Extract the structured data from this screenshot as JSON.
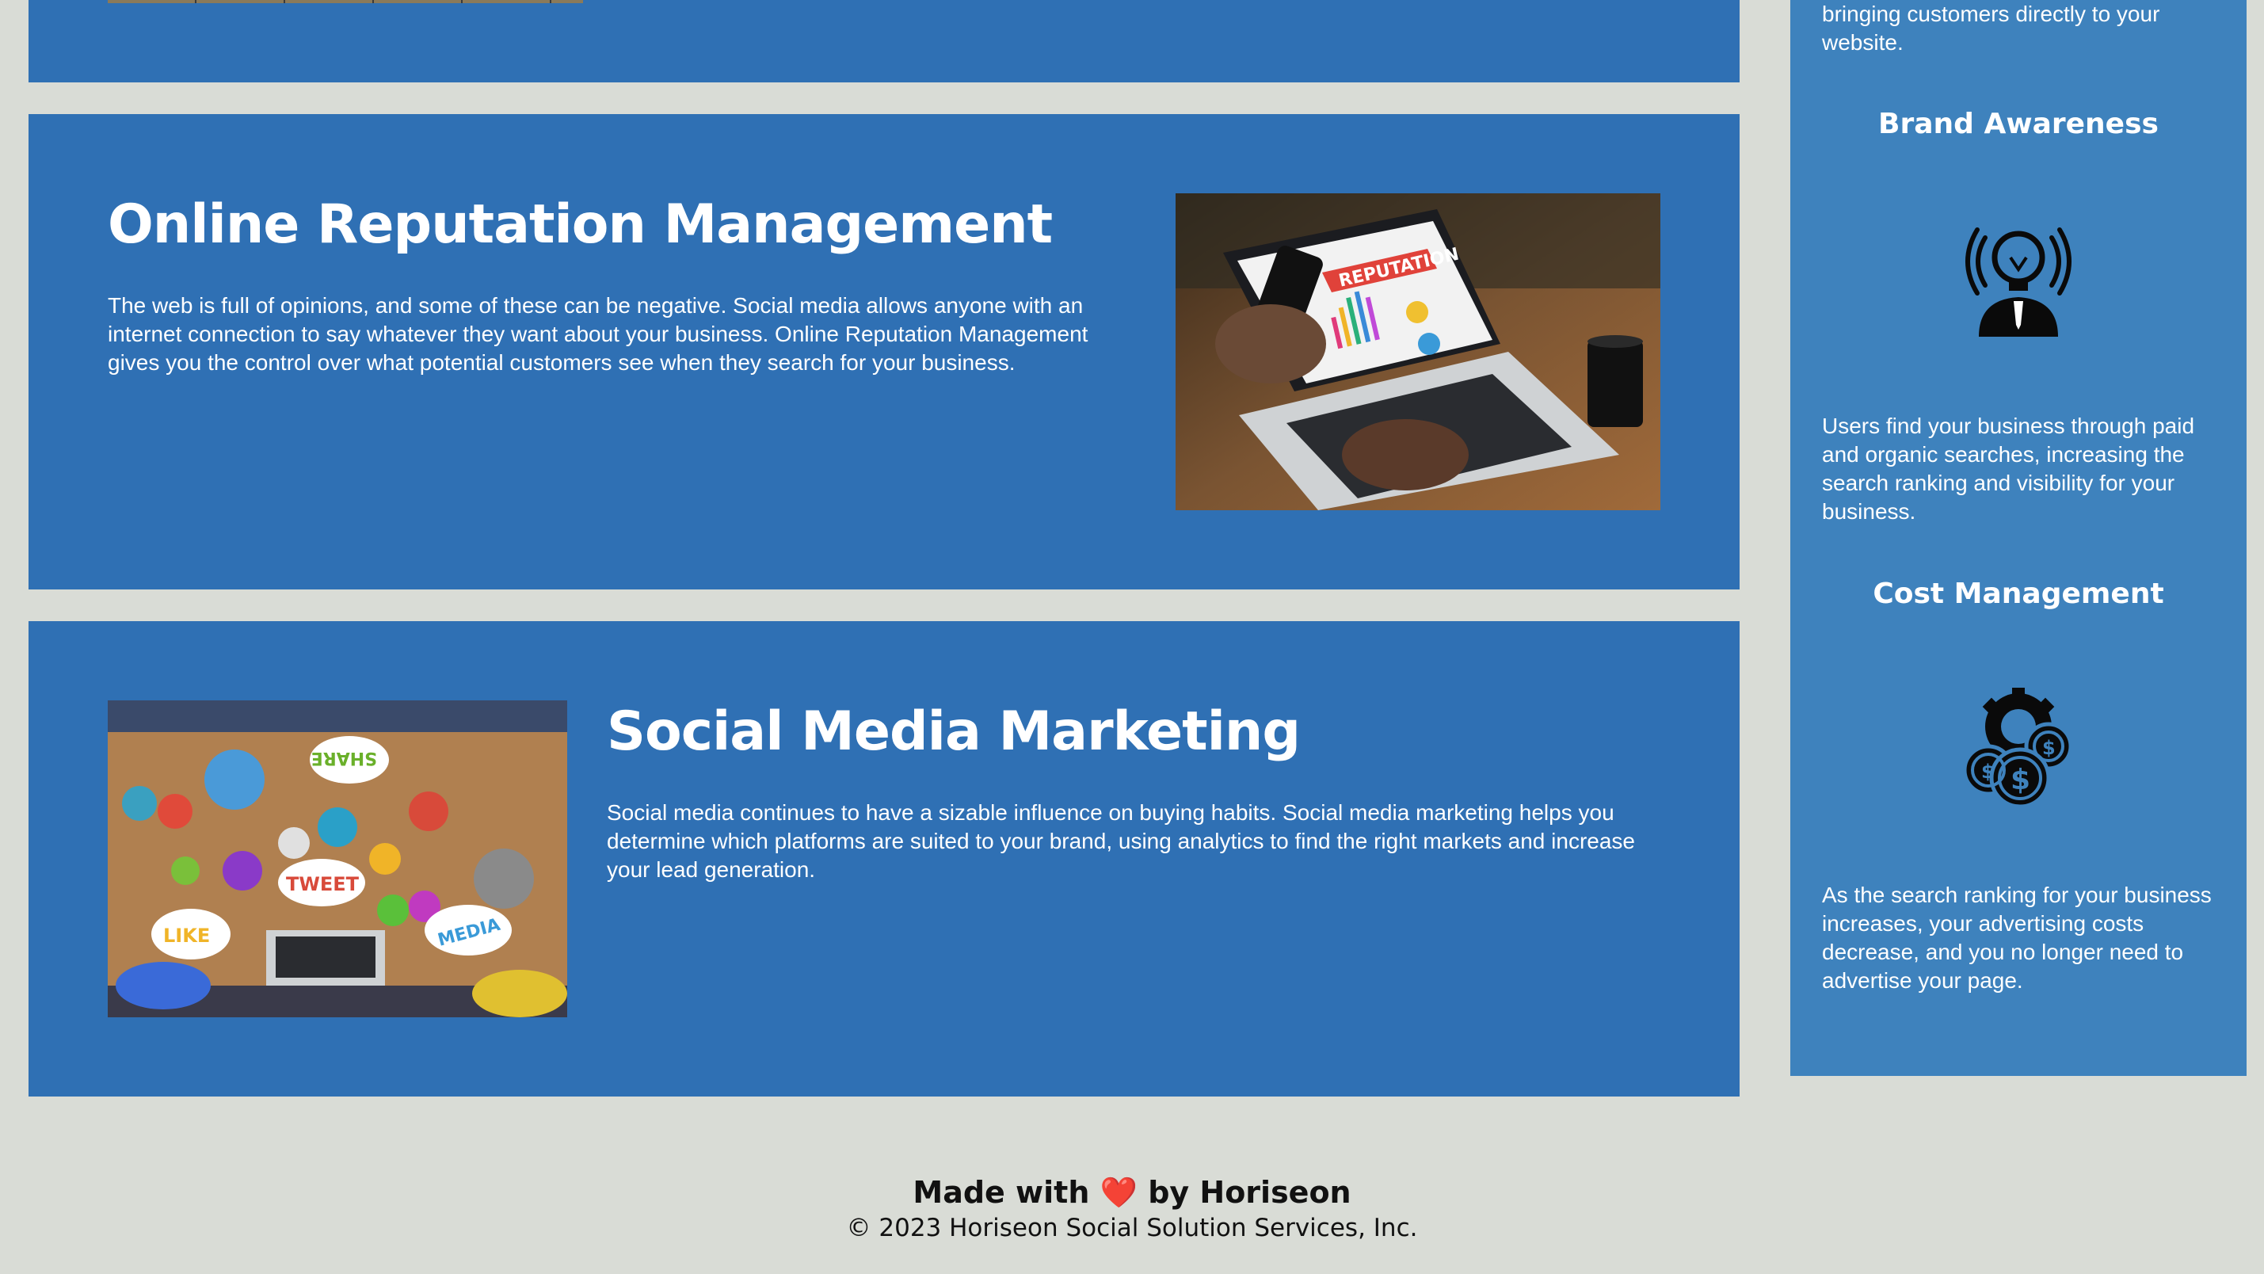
{
  "sidebar": {
    "intro_tail": "bringing customers directly to your website.",
    "sections": [
      {
        "title": "Brand Awareness",
        "icon": "lightbulb-person-icon",
        "text": "Users find your business through paid and organic searches, increasing the search ranking and visibility for your business."
      },
      {
        "title": "Cost Management",
        "icon": "gear-money-icon",
        "text": "As the search ranking for your business increases, your advertising costs decrease, and you no longer need to advertise your page."
      }
    ]
  },
  "content": {
    "online_reputation": {
      "title": "Online Reputation Management",
      "text": "The web is full of opinions, and some of these can be negative. Social media allows anyone with an internet connection to say whatever they want about your business. Online Reputation Management gives you the control over what potential customers see when they search for your business.",
      "image_label": "REPUTATION"
    },
    "social_media": {
      "title": "Social Media Marketing",
      "text": "Social media continues to have a sizable influence on buying habits. Social media marketing helps you determine which platforms are suited to your brand, using analytics to find the right markets and increase your lead generation.",
      "bubbles": [
        "SHARE",
        "TWEET",
        "LIKE",
        "MEDIA"
      ]
    }
  },
  "footer": {
    "made_prefix": "Made with",
    "heart": "❤️",
    "made_suffix": "by Horiseon",
    "copyright": "© 2023 Horiseon Social Solution Services, Inc."
  },
  "colors": {
    "page_bg": "#d9dcd6",
    "card_bg": "#2f70b4",
    "sidebar_bg": "#3e82bd",
    "heart": "#e0242a"
  }
}
